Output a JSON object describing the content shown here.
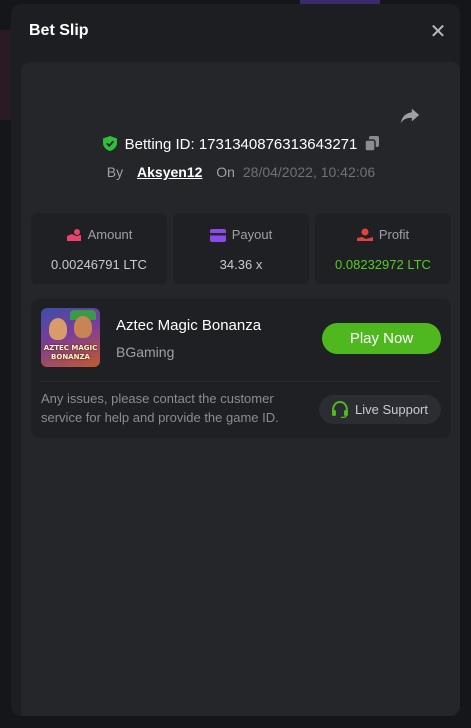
{
  "modal": {
    "title": "Bet Slip",
    "close_symbol": "✕"
  },
  "bet": {
    "betting_id_label": "Betting ID: 1731340876313643271",
    "by_label": "By",
    "username": "Aksyen12",
    "on_label": "On",
    "datetime": "28/04/2022, 10:42:06"
  },
  "stats": [
    {
      "label": "Amount",
      "value": "0.00246791 LTC",
      "icon": "coins-icon"
    },
    {
      "label": "Payout",
      "value": "34.36 x",
      "icon": "wallet-icon"
    },
    {
      "label": "Profit",
      "value": "0.08232972 LTC",
      "icon": "profit-hand-icon"
    }
  ],
  "game": {
    "thumb_title_line1": "AZTEC MAGIC",
    "thumb_title_line2": "BONANZA",
    "name": "Aztec Magic Bonanza",
    "provider": "BGaming",
    "play_label": "Play Now"
  },
  "support": {
    "help_text": "Any issues, please contact the customer service for help and provide the game ID.",
    "live_support_label": "Live Support"
  },
  "colors": {
    "accent_green": "#4fb81f",
    "profit_green": "#55cc22",
    "amount_icon": "#e8436b",
    "payout_icon": "#8a4be8",
    "profit_icon": "#e0433a"
  }
}
